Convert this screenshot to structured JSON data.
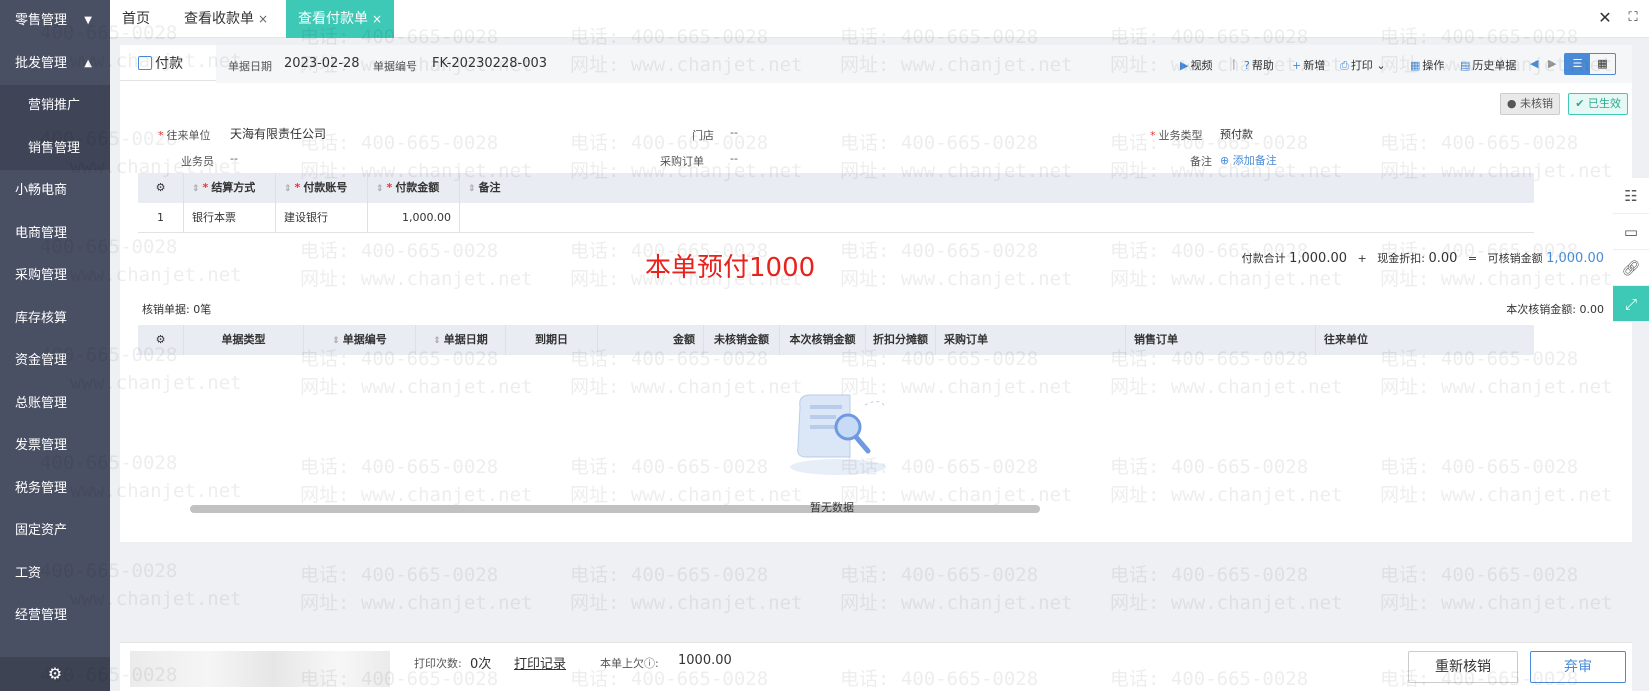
{
  "sidebar": {
    "items": [
      {
        "label": "零售管理",
        "caret": "▼"
      },
      {
        "label": "批发管理",
        "caret": "▲"
      },
      {
        "label": "营销推广",
        "sub": true
      },
      {
        "label": "销售管理",
        "sub": true
      },
      {
        "label": "小畅电商"
      },
      {
        "label": "电商管理"
      },
      {
        "label": "采购管理"
      },
      {
        "label": "库存核算"
      },
      {
        "label": "资金管理"
      },
      {
        "label": "总账管理"
      },
      {
        "label": "发票管理"
      },
      {
        "label": "税务管理"
      },
      {
        "label": "固定资产"
      },
      {
        "label": "工资"
      },
      {
        "label": "经营管理"
      }
    ],
    "gear_icon": "gear-icon"
  },
  "tabs": {
    "home": "首页",
    "receipt": "查看收款单",
    "payment": "查看付款单",
    "close_glyph": "×"
  },
  "window": {
    "close": "✕",
    "fullscreen": "⛶"
  },
  "header": {
    "doc_tab": "付款",
    "date_label": "单据日期",
    "date_value": "2023-02-28",
    "no_label": "单据编号",
    "no_value": "FK-20230228-003"
  },
  "toolbar": {
    "video": "视频",
    "help": "帮助",
    "add": "新增",
    "print": "打印",
    "operate": "操作",
    "history": "历史单据"
  },
  "status": {
    "unverified": "未核销",
    "effective": "已生效"
  },
  "form": {
    "partner_label": "往来单位",
    "partner_value": "天海有限责任公司",
    "store_label": "门店",
    "store_value": "--",
    "biz_type_label": "业务类型",
    "biz_type_value": "预付款",
    "salesman_label": "业务员",
    "salesman_value": "--",
    "po_label": "采购订单",
    "po_value": "--",
    "remark_label": "备注",
    "add_remark": "添加备注"
  },
  "settle_table": {
    "headers": [
      "结算方式",
      "付款账号",
      "付款金额",
      "备注"
    ],
    "rows": [
      {
        "index": "1",
        "method": "银行本票",
        "account": "建设银行",
        "amount": "1,000.00",
        "note": ""
      }
    ]
  },
  "annotation": "本单预付1000",
  "summary": {
    "total_label": "付款合计",
    "total_value": "1,000.00",
    "plus": "+",
    "discount_label": "现金折扣:",
    "discount_value": "0.00",
    "equals": "=",
    "verifiable_label": "可核销金额",
    "verifiable_value": "1,000.00"
  },
  "verify": {
    "count_label": "核销单据: 0笔",
    "amount_label": "本次核销金额: 0.00",
    "headers": [
      "单据类型",
      "单据编号",
      "单据日期",
      "到期日",
      "金额",
      "未核销金额",
      "本次核销金额",
      "折扣分摊额",
      "采购订单",
      "销售订单",
      "往来单位"
    ],
    "empty_text": "暂无数据"
  },
  "footer": {
    "print_count_label": "打印次数:",
    "print_count_value": "0次",
    "print_record": "打印记录",
    "last_owed_label": "本单上欠",
    "last_owed_value": "1000.00",
    "reverify_btn": "重新核销",
    "abandon_btn": "弃审"
  },
  "watermark": {
    "phone": "电话: 400-665-0028",
    "phone_short": "400-665-0028",
    "site": "网址: www.chanjet.net",
    "site_short": "www.chanjet.net"
  },
  "colors": {
    "sidebar": "#4a5064",
    "accent": "#3ec9b6",
    "link": "#4a8bd8",
    "annotation": "#e8231e"
  }
}
